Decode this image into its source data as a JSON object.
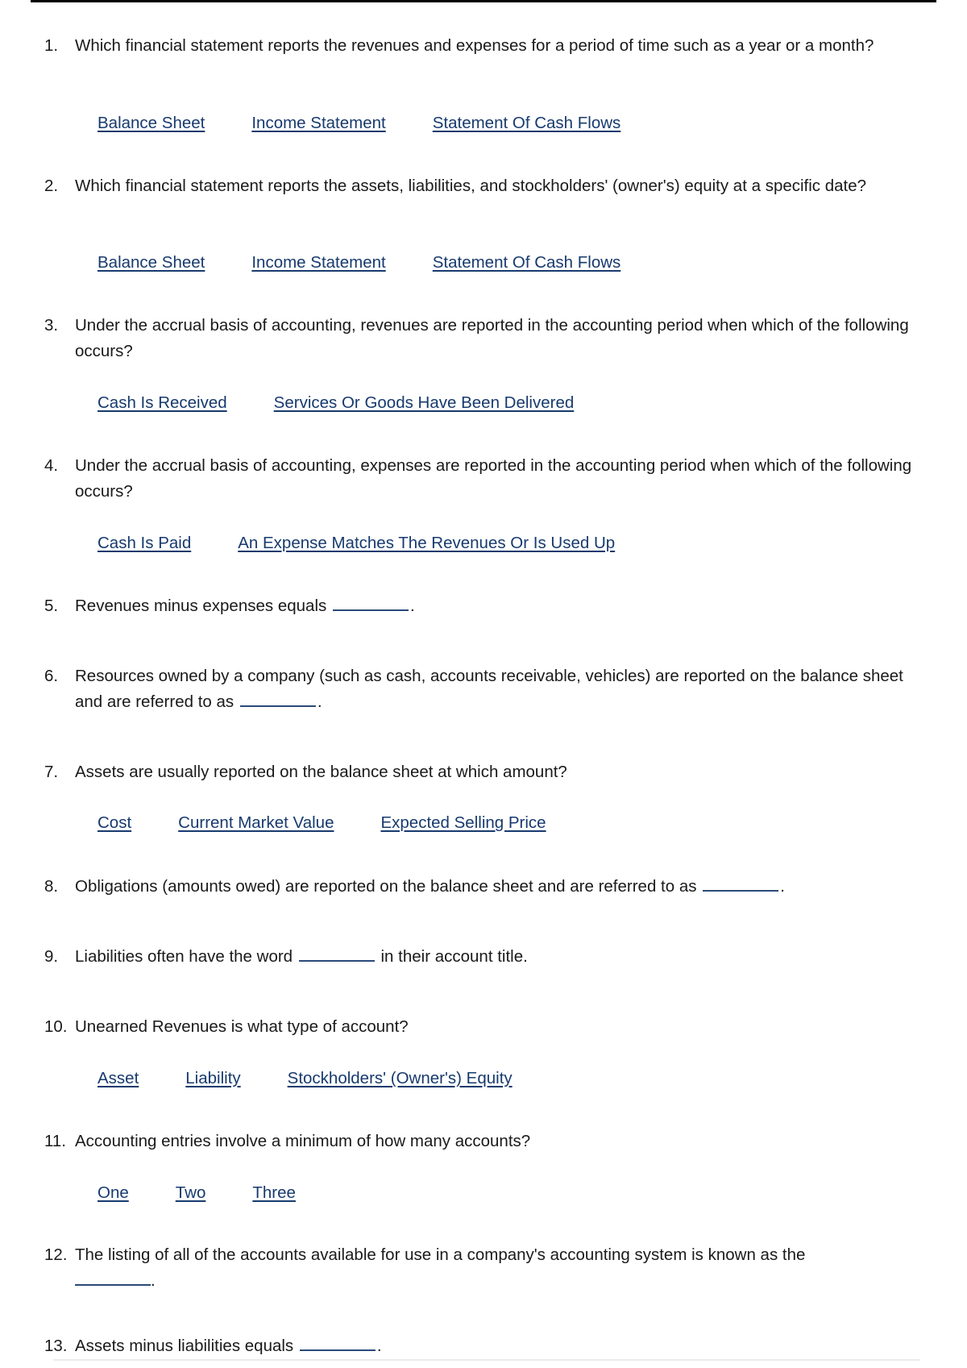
{
  "questions": [
    {
      "number": "1.",
      "text": "Which financial statement reports the revenues and expenses for a period of time such as a year or a month?",
      "options": [
        "Balance Sheet",
        "Income Statement",
        "Statement Of Cash Flows"
      ]
    },
    {
      "number": "2.",
      "text": "Which financial statement reports the assets, liabilities, and stockholders' (owner's) equity at a specific date?",
      "options": [
        "Balance Sheet",
        "Income Statement",
        "Statement Of Cash Flows"
      ]
    },
    {
      "number": "3.",
      "text": "Under the accrual basis of accounting, revenues are reported in the accounting period when which of the following occurs?",
      "options": [
        "Cash Is Received",
        "Services Or Goods Have Been Delivered"
      ]
    },
    {
      "number": "4.",
      "text": "Under the accrual basis of accounting, expenses are reported in the accounting period when which of the following occurs?",
      "options": [
        "Cash Is Paid",
        "An Expense Matches The Revenues Or Is Used Up"
      ]
    },
    {
      "number": "5.",
      "text_before": "Revenues minus expenses equals",
      "text_after": "."
    },
    {
      "number": "6.",
      "text_before": "Resources owned by a company (such as cash, accounts receivable, vehicles) are reported on the balance sheet and are referred to as",
      "text_after": "."
    },
    {
      "number": "7.",
      "text": "Assets are usually reported on the balance sheet at which amount?",
      "options": [
        "Cost",
        "Current Market Value",
        "Expected Selling Price"
      ]
    },
    {
      "number": "8.",
      "text_before": "Obligations (amounts owed) are reported on the balance sheet and are referred to as",
      "text_after": "."
    },
    {
      "number": "9.",
      "text_before": "Liabilities often have the word",
      "text_after": "in their account title."
    },
    {
      "number": "10.",
      "text": "Unearned Revenues is what type of account?",
      "options": [
        "Asset",
        "Liability",
        "Stockholders' (Owner's) Equity"
      ]
    },
    {
      "number": "11.",
      "text": "Accounting entries involve a minimum of how many accounts?",
      "options": [
        "One",
        "Two",
        "Three"
      ]
    },
    {
      "number": "12.",
      "text_before": "The listing of all of the accounts available for use in a company's accounting system is known as the",
      "text_after": "."
    },
    {
      "number": "13.",
      "text_before": "Assets minus liabilities equals",
      "text_after": "."
    }
  ],
  "colors": {
    "link": "#173a6e",
    "blank_underline": "#2a4a7a",
    "text": "#1a1a1a"
  }
}
